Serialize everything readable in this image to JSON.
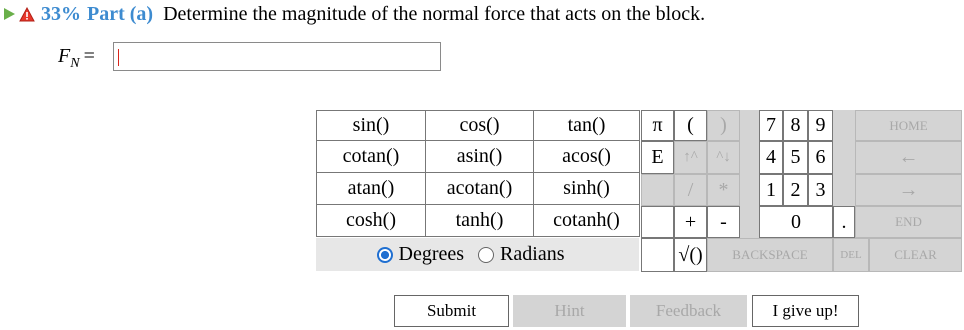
{
  "question": {
    "percent": "33%",
    "part": "Part (a)",
    "text": "Determine the magnitude of the normal force that acts on the block."
  },
  "answer": {
    "label_main": "F",
    "label_sub": "N",
    "label_eq": "=",
    "value": ""
  },
  "functions": [
    [
      "sin()",
      "cos()",
      "tan()"
    ],
    [
      "cotan()",
      "asin()",
      "acos()"
    ],
    [
      "atan()",
      "acotan()",
      "sinh()"
    ],
    [
      "cosh()",
      "tanh()",
      "cotanh()"
    ]
  ],
  "angle_mode": {
    "degrees": "Degrees",
    "radians": "Radians",
    "selected": "Degrees"
  },
  "keypad": {
    "pi": "π",
    "lparen": "(",
    "rparen": ")",
    "e": "E",
    "up": "↑^",
    "down": "^↓",
    "div": "/",
    "mul": "*",
    "plus": "+",
    "minus": "-",
    "sqrt": "√()",
    "backspace": "BACKSPACE",
    "del": "DEL",
    "clear": "CLEAR",
    "d7": "7",
    "d8": "8",
    "d9": "9",
    "d4": "4",
    "d5": "5",
    "d6": "6",
    "d1": "1",
    "d2": "2",
    "d3": "3",
    "d0": "0",
    "dot": ".",
    "home": "HOME",
    "left": "←",
    "right": "→",
    "end": "END"
  },
  "buttons": {
    "submit": "Submit",
    "hint": "Hint",
    "feedback": "Feedback",
    "give_up": "I give up!"
  }
}
